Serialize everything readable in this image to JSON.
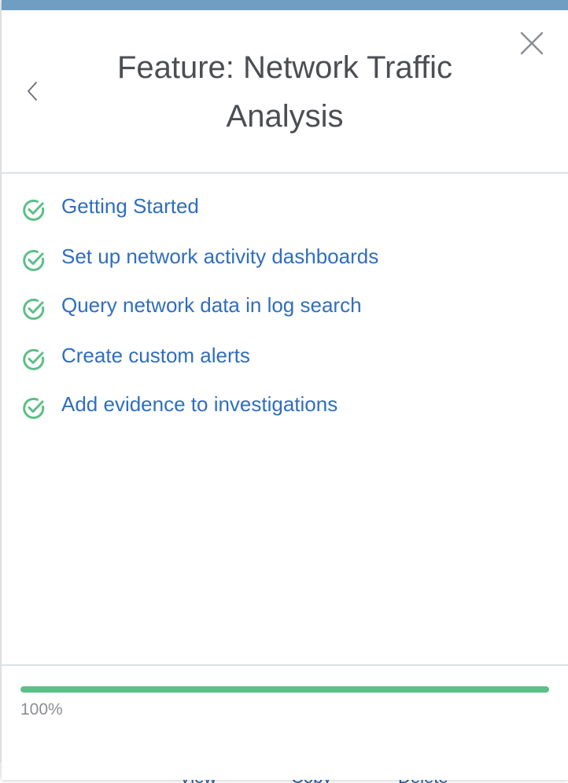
{
  "panel": {
    "title": "Feature: Network Traffic Analysis",
    "back_icon": "chevron-left-icon",
    "close_icon": "close-icon"
  },
  "steps": [
    {
      "label": "Getting Started",
      "status": "complete",
      "icon": "check-circle-icon"
    },
    {
      "label": "Set up network activity dashboards",
      "status": "complete",
      "icon": "check-circle-icon"
    },
    {
      "label": "Query network data in log search",
      "status": "complete",
      "icon": "check-circle-icon"
    },
    {
      "label": "Create custom alerts",
      "status": "complete",
      "icon": "check-circle-icon"
    },
    {
      "label": "Add evidence to investigations",
      "status": "complete",
      "icon": "check-circle-icon"
    }
  ],
  "progress": {
    "percent": 100,
    "label": "100%"
  },
  "background_actions": [
    "View",
    "Copy",
    "Delete"
  ],
  "colors": {
    "accent_bar": "#6f9ec2",
    "link": "#2f6ebf",
    "success": "#5cbf86",
    "title": "#4b4e52"
  }
}
